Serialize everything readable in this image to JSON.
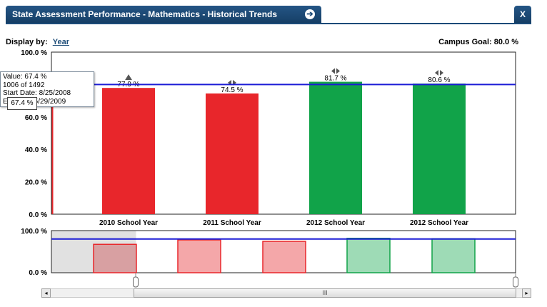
{
  "window": {
    "title": "State Assessment Performance - Mathematics - Historical Trends",
    "arrow_icon": "arrow-right-circle-icon",
    "close_label": "X"
  },
  "controls": {
    "display_by_label": "Display by:",
    "display_by_value": "Year",
    "campus_goal": "Campus Goal: 80.0 %"
  },
  "tooltip": {
    "value": "Value: 67.4 %",
    "count": "1006 of 1492",
    "start_date": "Start Date:  8/25/2008",
    "end_date_partial": "5/29/2009",
    "end_prefix": "E",
    "value_box": "67.4 %"
  },
  "colors": {
    "red": "#e8262b",
    "green": "#11a349",
    "goal_line": "#1b1bd6",
    "title_bar": "#1b4a78"
  },
  "chart_data": {
    "type": "bar",
    "categories": [
      "2010 School Year",
      "2011 School Year",
      "2012 School Year",
      "2012 School Year"
    ],
    "values": [
      77.9,
      74.5,
      81.7,
      80.6
    ],
    "labels": [
      "77.9 %",
      "74.5 %",
      "81.7 %",
      "80.6 %"
    ],
    "bar_colors": [
      "red",
      "red",
      "green",
      "green"
    ],
    "trend_markers": [
      "up",
      "flat",
      "flat",
      "flat"
    ],
    "first_partial_value": 67.4,
    "goal": 80.0,
    "ylim": [
      0,
      100
    ],
    "yticks": [
      "0.0 %",
      "20.0 %",
      "40.0 %",
      "60.0 %",
      "80.0 %",
      "100.0 %"
    ],
    "ytick_values": [
      0,
      20,
      40,
      60,
      80,
      100
    ],
    "grid": false,
    "legend": "none"
  },
  "navigator": {
    "yticks": [
      "100.0 %",
      "0.0 %"
    ],
    "values": [
      67.4,
      77.9,
      74.5,
      81.7,
      80.6
    ],
    "bar_colors": [
      "red",
      "red",
      "red",
      "green",
      "green"
    ]
  },
  "scrollbar": {
    "left_arrow": "◂",
    "right_arrow": "▸",
    "thumb_grip": "III"
  }
}
